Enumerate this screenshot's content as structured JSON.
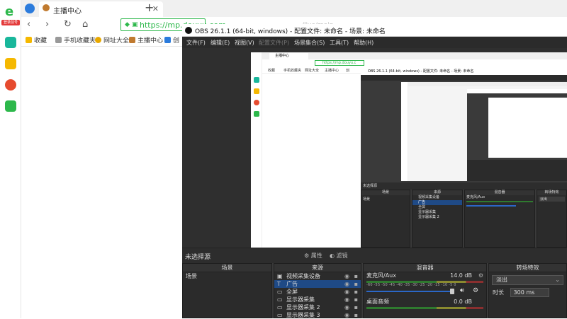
{
  "sidebar": {
    "logo_badge": "登录前号",
    "icons": [
      "app-icon",
      "star-icon",
      "weibo-icon",
      "mail-icon"
    ],
    "icon_colors": [
      "#19b79b",
      "#f5b800",
      "#e64b2f",
      "#2db84b"
    ]
  },
  "browser": {
    "tab_title": "主播中心",
    "url": "https://mp.douyu.com",
    "url_faded": "/live/main",
    "bookmarks": [
      "收藏",
      "手机收藏夹",
      "网址大全",
      "主播中心",
      "创"
    ]
  },
  "obs": {
    "title": "OBS 26.1.1 (64-bit, windows) - 配置文件: 未命名 - 场景: 未命名",
    "menu": [
      "文件(F)",
      "编辑(E)",
      "视图(V)",
      "配置文件(P)",
      "场景集合(S)",
      "工具(T)",
      "帮助(H)"
    ],
    "no_source_selected": "未选择源",
    "properties": "属性",
    "filters": "滤镜",
    "docks": {
      "scenes": {
        "title": "场景",
        "items": [
          "场景"
        ]
      },
      "sources": {
        "title": "来源",
        "items": [
          "视频采集设备",
          "广告",
          "全屏",
          "显示器采集",
          "显示器采集 2",
          "显示器采集 3"
        ]
      },
      "mixer": {
        "title": "混音器",
        "channels": [
          {
            "name": "麦克风/Aux",
            "db": "14.0 dB"
          },
          {
            "name": "桌面音频",
            "db": "0.0 dB"
          }
        ],
        "ticks": "-60 -55 -50 -45 -40 -35 -30 -25 -20 -15 -10 -5 0"
      },
      "transitions": {
        "title": "转场特效",
        "selected": "淡出",
        "duration_label": "时长",
        "duration_value": "300 ms"
      }
    },
    "nested": {
      "title": "OBS 26.1.1 (64-bit, windows) - 配置文件: 未命名 - 场景: 未命名",
      "tab_title": "主播中心",
      "url": "https://mp.douyu.c",
      "bookmarks": [
        "收藏",
        "手机收藏夹",
        "网址大全",
        "主播中心",
        "创"
      ],
      "scenes": "场景",
      "sources": "来源",
      "mixer": "混音器",
      "transitions": "转场特效",
      "scene_item": "场景",
      "source_items": [
        "视频采集设备",
        "广告",
        "全屏",
        "显示器采集",
        "显示器采集 2"
      ],
      "mixer_ch": "麦克风/Aux",
      "trans_sel": "淡出",
      "no_source": "未选择源"
    }
  }
}
